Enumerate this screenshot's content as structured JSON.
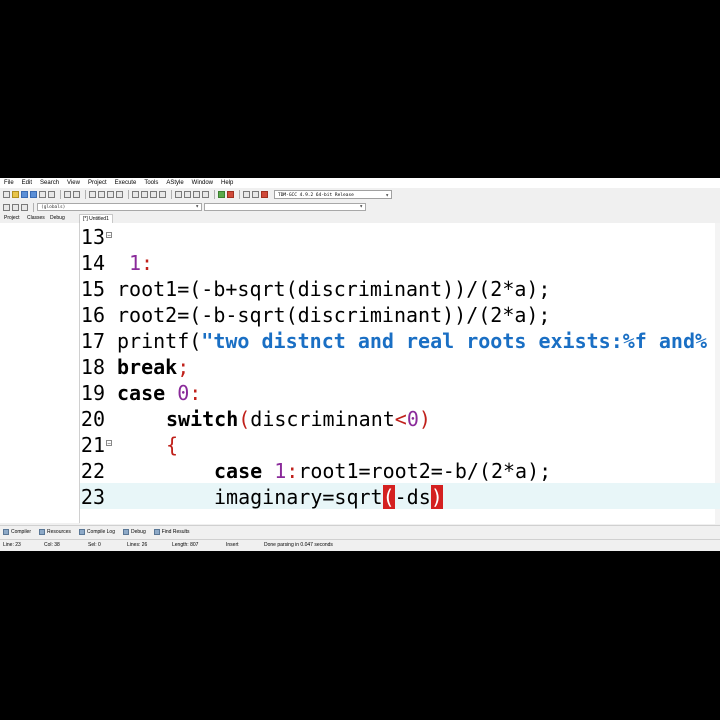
{
  "menu": [
    "File",
    "Edit",
    "Search",
    "View",
    "Project",
    "Execute",
    "Tools",
    "AStyle",
    "Window",
    "Help"
  ],
  "toolbar": {
    "compiler": "TDM-GCC 4.9.2 64-bit Release"
  },
  "toolbar2": {
    "globals": "(globals)",
    "function": ""
  },
  "panel_tabs": [
    "Project",
    "Classes",
    "Debug"
  ],
  "editor_tab": "[*] Untitled1",
  "code_lines": [
    {
      "num": "13",
      "current": false
    },
    {
      "num": "14",
      "current": false
    },
    {
      "num": "15",
      "current": false
    },
    {
      "num": "16",
      "current": false
    },
    {
      "num": "17",
      "current": false
    },
    {
      "num": "18",
      "current": false
    },
    {
      "num": "19",
      "current": false
    },
    {
      "num": "20",
      "current": false
    },
    {
      "num": "21",
      "current": false
    },
    {
      "num": "22",
      "current": false
    },
    {
      "num": "23",
      "current": true
    }
  ],
  "code": {
    "l14": {
      "num": "1",
      "op": ":"
    },
    "l15": "root1=(-b+sqrt(discriminant))/(2*a);",
    "l16": "root2=(-b-sqrt(discriminant))/(2*a);",
    "l17": {
      "fn": "printf(",
      "str": "\"two distnct and real roots exists:%f and%"
    },
    "l18": {
      "kw": "break",
      "op": ";"
    },
    "l19": {
      "kw": "case",
      "num": "0",
      "op": ":"
    },
    "l20": {
      "kw": "switch",
      "rest": "discriminant",
      "op": "<",
      "num": "0"
    },
    "l21": "{",
    "l22": {
      "kw": "case",
      "num": "1",
      "rest": "root1=root2=-b/(2*a);"
    },
    "l23": {
      "a": "imaginary=sqrt",
      "b": "-ds"
    }
  },
  "bottom_tabs": [
    "Compiler",
    "Resources",
    "Compile Log",
    "Debug",
    "Find Results"
  ],
  "status": {
    "line": "Line: 23",
    "col": "Col: 38",
    "sel": "Sel: 0",
    "lines": "Lines: 26",
    "length": "Length: 807",
    "mode": "Insert",
    "msg": "Done parsing in 0.047 seconds"
  },
  "colors": {
    "operator": "#c0201a",
    "number": "#8a2a9a",
    "string": "#1a6fc4",
    "current_line": "#e8f6f8",
    "brace_highlight": "#d42020"
  }
}
